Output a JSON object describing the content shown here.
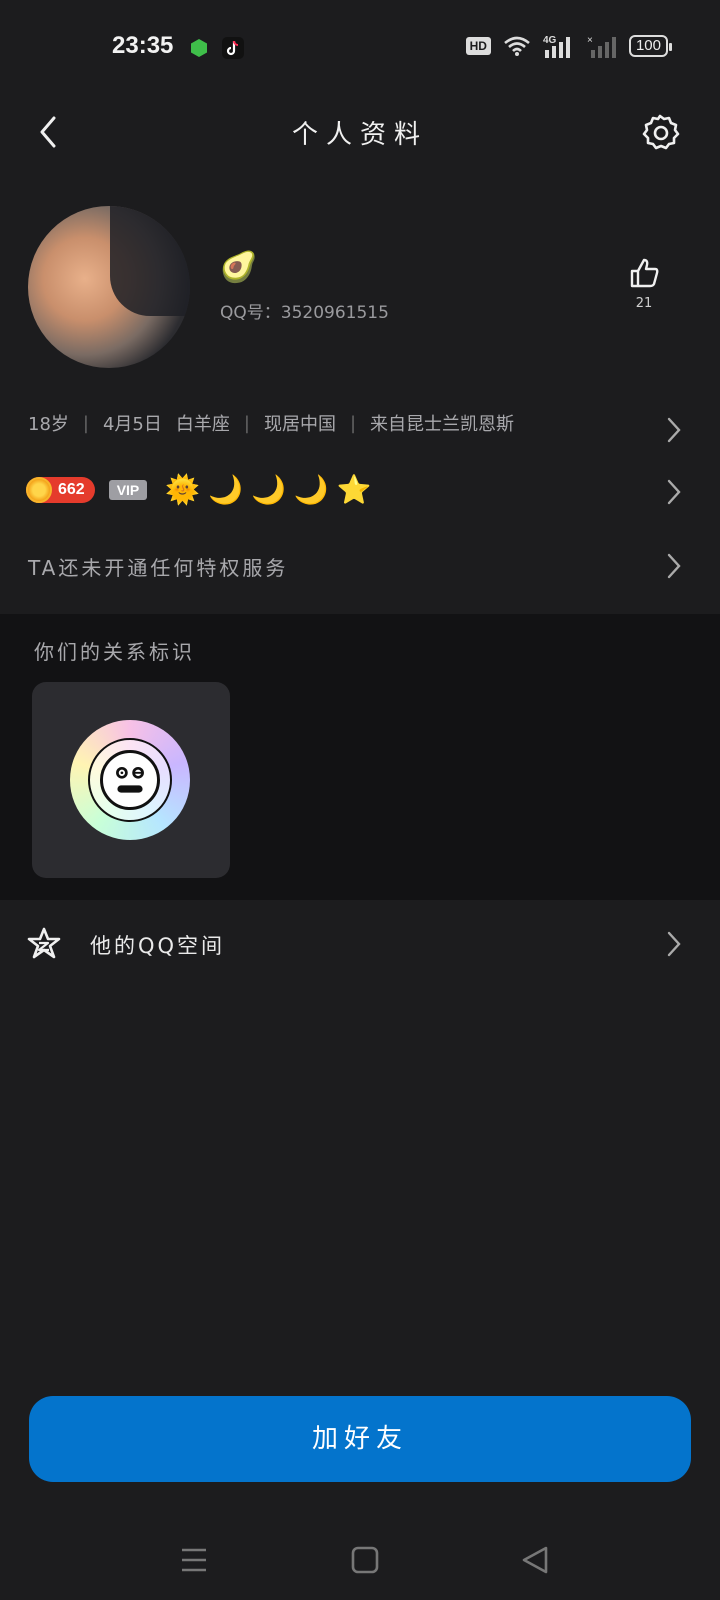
{
  "status_bar": {
    "time": "23:35",
    "hd": "HD",
    "network": "4G",
    "battery": "100"
  },
  "header": {
    "title": "个人资料"
  },
  "profile": {
    "nickname": "🥑",
    "qq_label": "QQ号：3520961515",
    "likes": "21"
  },
  "info": {
    "age": "18岁",
    "birthday": "4月5日",
    "zodiac": "白羊座",
    "location": "现居中国",
    "hometown": "来自昆士兰凯恩斯"
  },
  "badges": {
    "level": "662",
    "vip": "VIP"
  },
  "privilege_text": "TA还未开通任何特权服务",
  "relation": {
    "title": "你们的关系标识"
  },
  "qzone": {
    "label": "他的QQ空间"
  },
  "actions": {
    "add_friend": "加好友"
  },
  "colors": {
    "background": "#1c1c1e",
    "section_dark": "#121214",
    "primary_button": "#0474cc",
    "level_badge": "#e53b2c"
  }
}
